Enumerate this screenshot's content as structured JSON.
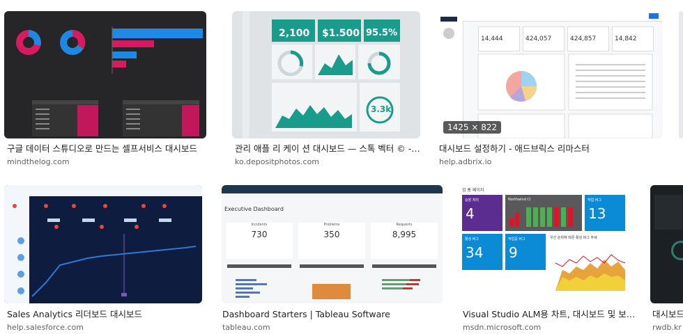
{
  "results": [
    {
      "title": "구글 데이터 스튜디오로 만드는 셀프서비스 대시보드",
      "source": "mindthelog.com"
    },
    {
      "title": "관리 애플 리 케이 션 대시보드 — 스톡 벡터 © -izab…",
      "source": "ko.depositphotos.com"
    },
    {
      "title": "대시보드 설정하기 - 애드브릭스 리마스터",
      "source": "help.adbrix.io",
      "badge": "1425 × 822"
    },
    {
      "title": "Sales Analytics 리더보드 대시보드",
      "source": "help.salesforce.com"
    },
    {
      "title": "Dashboard Starters | Tableau Software",
      "source": "tableau.com"
    },
    {
      "title": "Visual Studio ALM용 차트, 대시보드 및 보고서",
      "source": "msdn.microsoft.com"
    },
    {
      "title": "대시보드",
      "source": "rwdb.kr"
    }
  ],
  "thumb_text": {
    "t2": {
      "v1": "2,100",
      "v2": "$1.500",
      "v3": "95.5%",
      "v4": "3.3k"
    },
    "t3": {
      "v1": "14,444",
      "v2": "424,057",
      "v3": "424,857",
      "v4": "14,842"
    },
    "t5": {
      "header": "Executive Dashboard",
      "k1": "730",
      "k2": "350",
      "k3": "8,995",
      "l1": "Incidents",
      "l2": "Problems",
      "l3": "Requests"
    },
    "t6": {
      "header": "업 홈 페이지",
      "tile1_label": "승장 처리",
      "tile1_value": "4",
      "tile2_label": "Northwind CI",
      "tile3_label": "작업 버그",
      "tile3_value": "13",
      "tile4_label": "활성 버그",
      "tile4_value": "34",
      "tile5_label": "작업중 버그",
      "tile5_value": "9",
      "tile6_label": "우선 순위에 따른 활성 버그 추세"
    }
  },
  "colors": {
    "accent_blue": "#1a73e8",
    "teal": "#1a9c8c",
    "purple": "#5c2d91",
    "cyan": "#0b8bd6",
    "green": "#4caf50"
  }
}
